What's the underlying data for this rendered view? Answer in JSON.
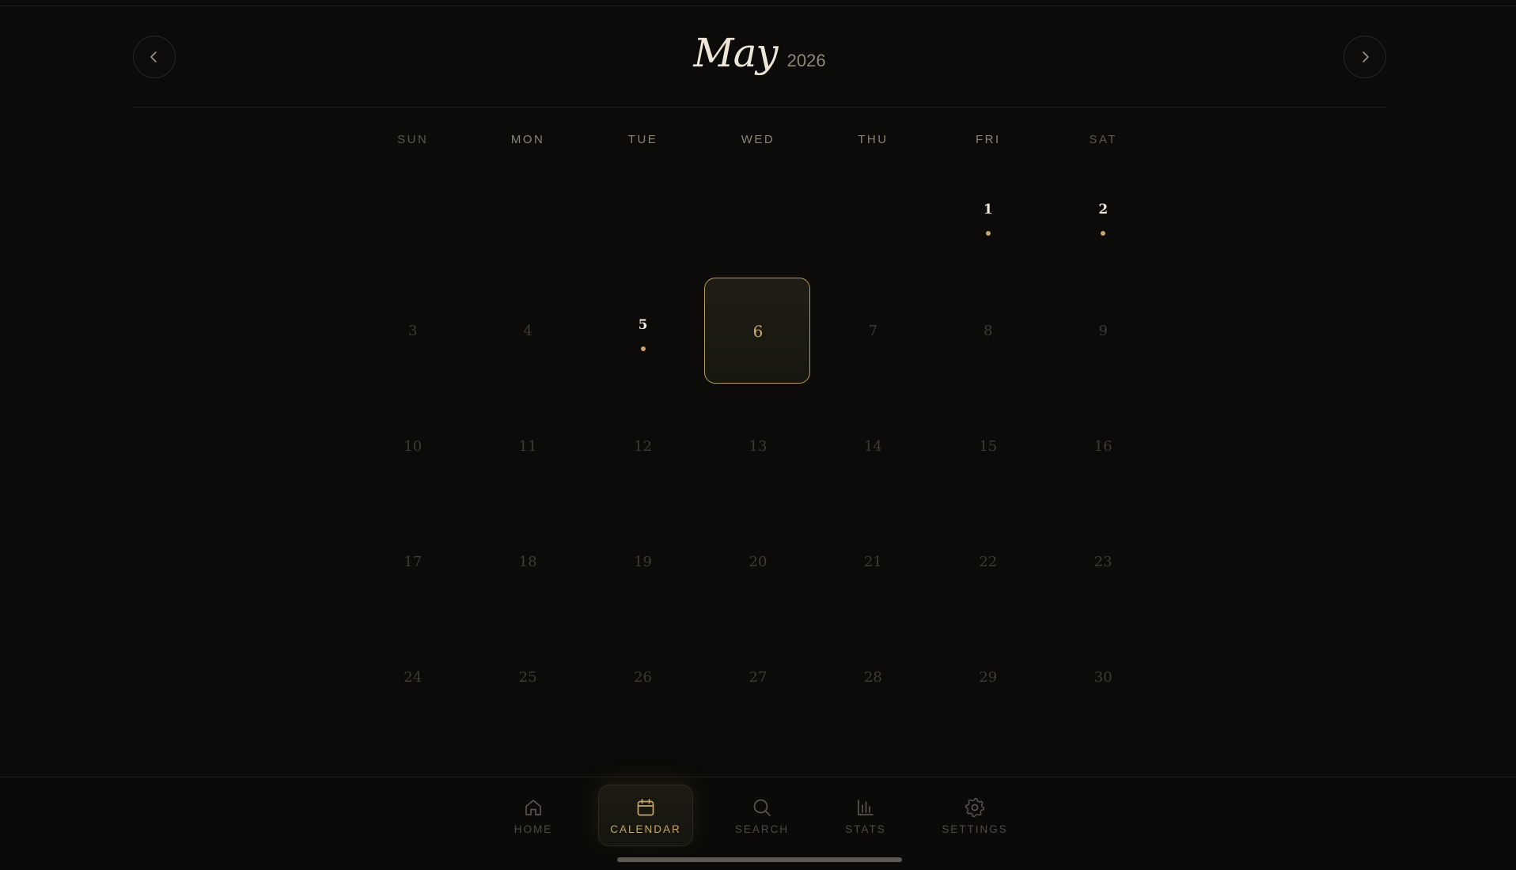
{
  "header": {
    "month": "May",
    "year": "2026",
    "prev_icon": "chevron-left-icon",
    "next_icon": "chevron-right-icon"
  },
  "weekdays": [
    "SUN",
    "MON",
    "TUE",
    "WED",
    "THU",
    "FRI",
    "SAT"
  ],
  "calendar": {
    "today": "6",
    "weeks": [
      [
        "",
        "",
        "",
        "",
        "",
        "1",
        "2"
      ],
      [
        "3",
        "4",
        "5",
        "6",
        "7",
        "8",
        "9"
      ],
      [
        "10",
        "11",
        "12",
        "13",
        "14",
        "15",
        "16"
      ],
      [
        "17",
        "18",
        "19",
        "20",
        "21",
        "22",
        "23"
      ],
      [
        "24",
        "25",
        "26",
        "27",
        "28",
        "29",
        "30"
      ]
    ],
    "event_days": [
      "1",
      "2",
      "5"
    ]
  },
  "tabs": [
    {
      "label": "HOME",
      "icon": "home-icon",
      "active": false
    },
    {
      "label": "CALENDAR",
      "icon": "calendar-icon",
      "active": true
    },
    {
      "label": "SEARCH",
      "icon": "search-icon",
      "active": false
    },
    {
      "label": "STATS",
      "icon": "bar-chart-icon",
      "active": false
    },
    {
      "label": "SETTINGS",
      "icon": "gear-icon",
      "active": false
    }
  ],
  "colors": {
    "background": "#0c0b09",
    "accent_gold": "#c8a36a",
    "today_border": "#b39a62"
  }
}
